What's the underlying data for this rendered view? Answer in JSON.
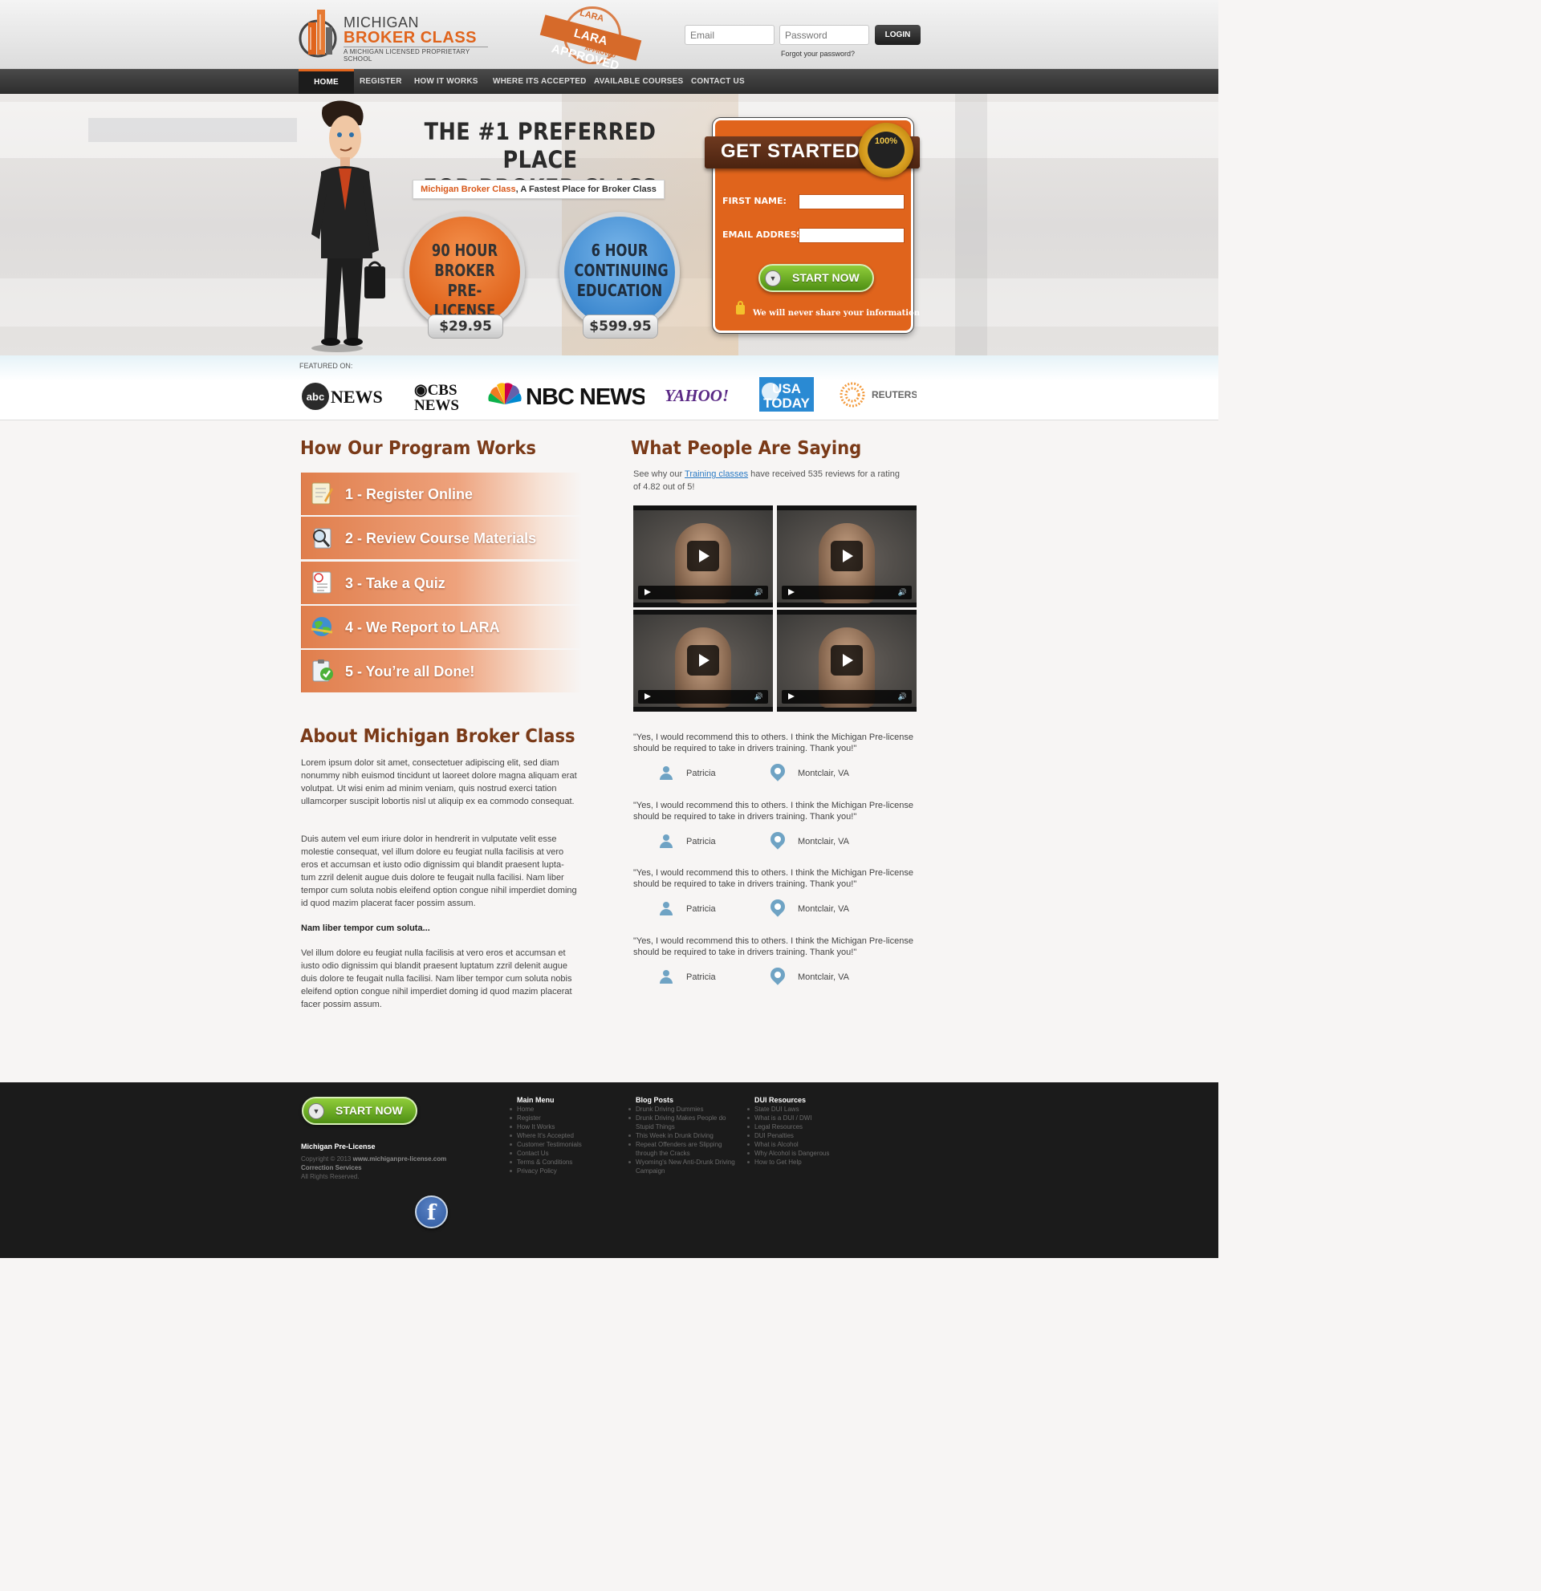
{
  "header": {
    "logo_line1": "MICHIGAN",
    "logo_line2": "BROKER CLASS",
    "logo_tagline": "A MICHIGAN LICENSED PROPRIETARY SCHOOL",
    "stamp_top": "LARA",
    "stamp_main": "LARA APPROVED",
    "stamp_bottom": "APPROVED",
    "email_placeholder": "Email",
    "password_placeholder": "Password",
    "login_label": "LOGIN",
    "forgot_label": "Forgot your password?"
  },
  "nav": {
    "items": [
      "HOME",
      "REGISTER",
      "HOW IT WORKS",
      "WHERE ITS ACCEPTED",
      "AVAILABLE COURSES",
      "CONTACT US"
    ],
    "active": "HOME"
  },
  "hero": {
    "title_line1": "THE #1 PREFERRED PLACE",
    "title_line2": "FOR BROKER CLASS",
    "tag_brand": "Michigan Broker Class",
    "tag_rest": ", A Fastest Place for Broker Class",
    "course1": {
      "line1": "90 HOUR",
      "line2": "BROKER",
      "line3": "PRE-LICENSE",
      "price": "$29.95"
    },
    "course2": {
      "line1": "6 HOUR",
      "line2": "CONTINUING",
      "line3": "EDUCATION",
      "price": "$599.95"
    }
  },
  "get_started": {
    "title": "GET STARTED",
    "seal": "100%",
    "first_name_label": "FIRST NAME:",
    "email_label": "EMAIL ADDRESS:",
    "button_label": "START NOW",
    "privacy_note": "We will never share your information"
  },
  "featured": {
    "label": "FEATURED ON:",
    "brands": [
      "abcNEWS",
      "CBS NEWS",
      "NBC NEWS",
      "YAHOO!",
      "USA TODAY",
      "REUTERS"
    ]
  },
  "program": {
    "heading": "How Our Program Works",
    "steps": [
      "1 - Register Online",
      "2 - Review Course Materials",
      "3 - Take a Quiz",
      "4 - We Report to LARA",
      "5 - You’re all Done!"
    ]
  },
  "about": {
    "heading": "About Michigan Broker Class",
    "para1": "Lorem ipsum dolor sit amet, consectetuer adipiscing elit, sed diam nonummy nibh euismod tincidunt ut laoreet dolore magna aliquam erat volutpat. Ut wisi enim ad minim veniam, quis nostrud exerci tation ullamcorper suscipit lobortis nisl ut aliquip ex ea commodo consequat.",
    "para2": "Duis autem vel eum iriure dolor in hendrerit in vulputate velit esse molestie consequat, vel illum dolore eu feugiat nulla facilisis at vero eros et accumsan et iusto odio dignissim qui blandit praesent lupta-tum zzril delenit augue duis dolore te feugait nulla facilisi. Nam liber tempor cum soluta nobis eleifend option congue nihil imperdiet doming id quod mazim placerat facer possim assum.",
    "subheading": "Nam liber tempor cum soluta...",
    "para3": "Vel illum dolore eu feugiat nulla facilisis at vero eros et accumsan et iusto odio dignissim qui blandit praesent luptatum zzril delenit augue duis dolore te feugait nulla facilisi. Nam liber tempor cum soluta nobis eleifend option congue nihil imperdiet doming id quod mazim placerat facer possim assum."
  },
  "reviews": {
    "heading": "What People Are Saying",
    "intro_pre": "See why our ",
    "intro_link": "Training classes",
    "intro_post": " have received 535 reviews for a rating of 4.82 out of 5!",
    "items": [
      {
        "quote": "\"Yes, I would recommend this to others. I think the Michigan Pre-license should be required to take in drivers training. Thank you!\"",
        "name": "Patricia",
        "location": "Montclair, VA"
      },
      {
        "quote": "\"Yes, I would recommend this to others. I think the Michigan Pre-license should be required to take in drivers training. Thank you!\"",
        "name": "Patricia",
        "location": "Montclair, VA"
      },
      {
        "quote": "\"Yes, I would recommend this to others. I think the Michigan Pre-license should be required to take in drivers training. Thank you!\"",
        "name": "Patricia",
        "location": "Montclair, VA"
      },
      {
        "quote": "\"Yes, I would recommend this to others. I think the Michigan Pre-license should be required to take in drivers training. Thank you!\"",
        "name": "Patricia",
        "location": "Montclair, VA"
      }
    ]
  },
  "footer": {
    "button_label": "START NOW",
    "site_name": "Michigan Pre-License",
    "copyright": "Copyright © 2013",
    "site_url": "www.michiganpre-license.com",
    "correction": "Correction Services",
    "rights": "All Rights Reserved.",
    "facebook": "f",
    "columns": [
      {
        "title": "Main Menu",
        "links": [
          "Home",
          "Register",
          "How It Works",
          "Where It's Accepted",
          "Customer Testimonials",
          "Contact Us",
          "Terms & Conditions",
          "Privacy Policy"
        ]
      },
      {
        "title": "Blog Posts",
        "links": [
          "Drunk Driving Dummies",
          "Drunk Driving Makes People do Stupid Things",
          "This Week in Drunk Driving",
          "Repeat Offenders are Slipping through the Cracks",
          "Wyoming's New Anti-Drunk Driving Campaign"
        ]
      },
      {
        "title": "DUI Resources",
        "links": [
          "State DUI Laws",
          "What is a DUI / DWI",
          "Legal Resources",
          "DUI Penalties",
          "What is Alcohol",
          "Why Alcohol is Dangerous",
          "How to Get Help"
        ]
      }
    ]
  },
  "colors": {
    "accent": "#e0641c",
    "heading": "#7a3a18",
    "nav": "#2d2d2d",
    "footer": "#1b1b1b",
    "button_green": "#6aad26"
  }
}
